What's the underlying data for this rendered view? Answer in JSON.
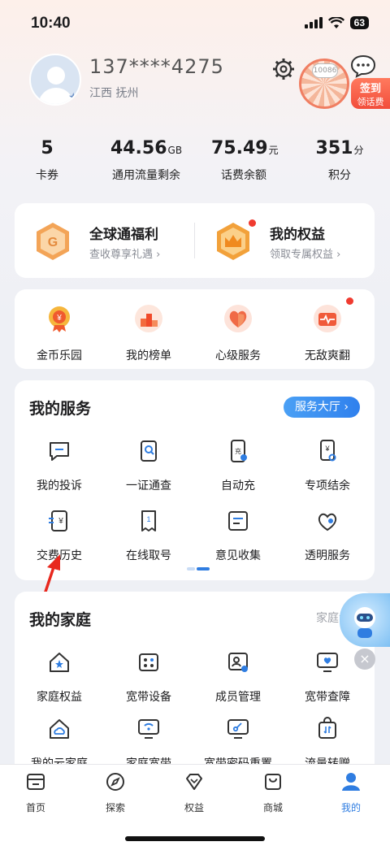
{
  "status_bar": {
    "time": "10:40",
    "battery": "63"
  },
  "profile": {
    "phone": "137****4275",
    "location": "江西 抚州"
  },
  "sign_in": {
    "bubble": "10086",
    "line1": "签到",
    "line2": "领话费"
  },
  "stats": [
    {
      "value": "5",
      "unit": "",
      "label": "卡券"
    },
    {
      "value": "44.56",
      "unit": "GB",
      "label": "通用流量剩余"
    },
    {
      "value": "75.49",
      "unit": "元",
      "label": "话费余额"
    },
    {
      "value": "351",
      "unit": "分",
      "label": "积分"
    }
  ],
  "welfare": [
    {
      "title": "全球通福利",
      "subtitle": "查收尊享礼遇",
      "icon": "hexagon-g-icon"
    },
    {
      "title": "我的权益",
      "subtitle": "领取专属权益",
      "icon": "crown-icon"
    }
  ],
  "quick": [
    {
      "label": "金币乐园",
      "icon": "medal-icon"
    },
    {
      "label": "我的榜单",
      "icon": "podium-icon"
    },
    {
      "label": "心级服务",
      "icon": "heart-icon"
    },
    {
      "label": "无敌爽翻",
      "icon": "gift-card-icon"
    }
  ],
  "services": {
    "title": "我的服务",
    "hall_button": "服务大厅 ›",
    "items": [
      {
        "label": "我的投诉",
        "icon": "complaint-icon"
      },
      {
        "label": "一证通查",
        "icon": "id-search-icon"
      },
      {
        "label": "自动充",
        "icon": "auto-recharge-icon"
      },
      {
        "label": "专项结余",
        "icon": "balance-icon"
      },
      {
        "label": "交费历史",
        "icon": "payment-history-icon"
      },
      {
        "label": "在线取号",
        "icon": "queue-ticket-icon"
      },
      {
        "label": "意见收集",
        "icon": "feedback-icon"
      },
      {
        "label": "透明服务",
        "icon": "transparent-service-icon"
      }
    ]
  },
  "family": {
    "title": "我的家庭",
    "more": "家庭专",
    "items": [
      {
        "label": "家庭权益",
        "icon": "home-star-icon"
      },
      {
        "label": "宽带设备",
        "icon": "router-icon"
      },
      {
        "label": "成员管理",
        "icon": "member-card-icon"
      },
      {
        "label": "宽带查障",
        "icon": "monitor-heart-icon"
      },
      {
        "label": "我的云家庭",
        "icon": "cloud-home-icon"
      },
      {
        "label": "家庭宽带",
        "icon": "wifi-monitor-icon"
      },
      {
        "label": "宽带密码重置",
        "icon": "key-monitor-icon"
      },
      {
        "label": "流量转赠",
        "icon": "transfer-bag-icon"
      }
    ]
  },
  "tabs": [
    {
      "label": "首页",
      "icon": "home-icon",
      "active": false
    },
    {
      "label": "探索",
      "icon": "compass-icon",
      "active": false
    },
    {
      "label": "权益",
      "icon": "diamond-icon",
      "active": false
    },
    {
      "label": "商城",
      "icon": "shopping-bag-icon",
      "active": false
    },
    {
      "label": "我的",
      "icon": "person-icon",
      "active": true
    }
  ],
  "colors": {
    "accent": "#2f7de1",
    "badge_red": "#f03b30",
    "gold": "#f0a33c"
  }
}
